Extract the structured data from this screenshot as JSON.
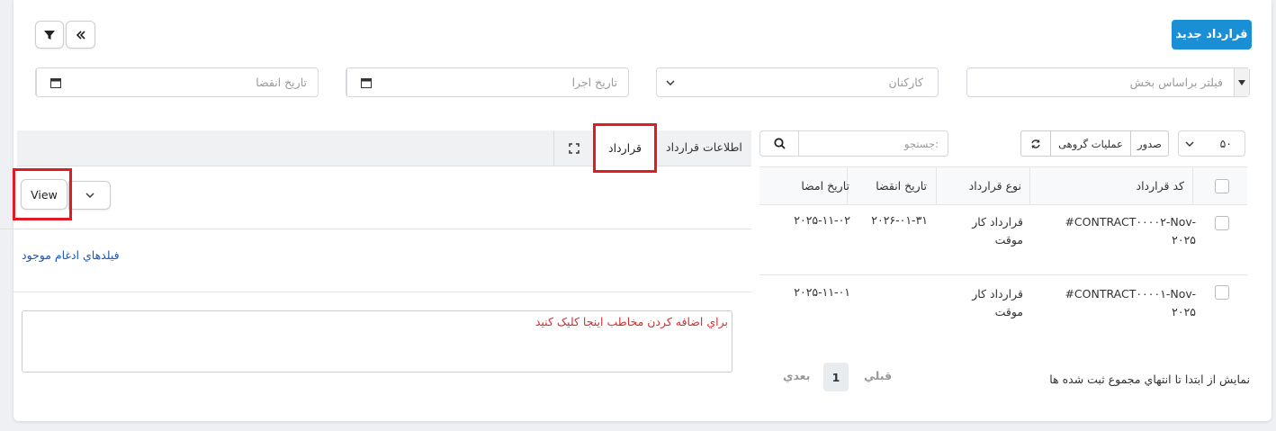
{
  "header": {
    "new_contract": "قرارداد جدید"
  },
  "filters": {
    "expire_date": "تاریخ انقضا",
    "exec_date": "تاریخ اجرا",
    "staff": "کارکنان",
    "section": "فیلتر براساس بخش"
  },
  "toolbar": {
    "page_size": "۵۰",
    "export": "صدور",
    "bulk": "عملیات گروهی",
    "search_placeholder": "جستجو:"
  },
  "table": {
    "columns": [
      "کد قرارداد",
      "نوع قرارداد",
      "تاریخ انقضا",
      "تاریخ امضا"
    ],
    "rows": [
      {
        "code": "#CONTRACT۰۰۰۰۲-Nov-",
        "code2": "۲۰۲۵",
        "type": "قرارداد کار",
        "type2": "موقت",
        "expire": "۲۰۲۶-۰۱-۳۱",
        "sign": "۲۰۲۵-۱۱-۰۲"
      },
      {
        "code": "#CONTRACT۰۰۰۰۱-Nov-",
        "code2": "۲۰۲۵",
        "type": "قرارداد کار",
        "type2": "موقت",
        "expire": "",
        "sign": "۲۰۲۵-۱۱-۰۱"
      }
    ]
  },
  "footer": {
    "info": "نمایش از ابتدا تا انتهاي مجموع ثبت شده ها",
    "prev": "قبلي",
    "page": "1",
    "next": "بعدي"
  },
  "panel": {
    "tab_info": "اطلاعات قرارداد",
    "tab_contract": "قرارداد",
    "view_button": "View",
    "merge_fields": "فیلدهاي ادغام موجود",
    "add_contact": "براي اضافه کردن مخاطب اينجا کليک کنيد"
  },
  "colors": {
    "primary": "#1a8fd6",
    "highlight": "#e01b24",
    "link": "#1a56b8",
    "warn": "#d32f2f"
  }
}
